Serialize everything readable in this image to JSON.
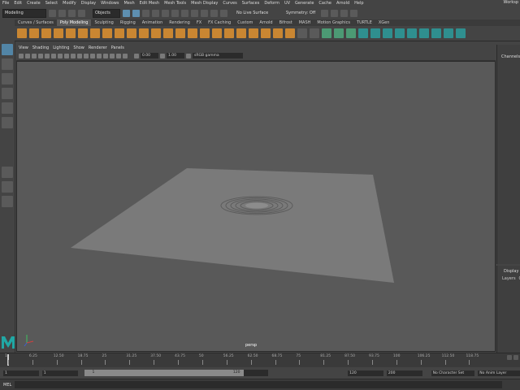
{
  "menubar": {
    "items": [
      "File",
      "Edit",
      "Create",
      "Select",
      "Modify",
      "Display",
      "Windows",
      "Mesh",
      "Edit Mesh",
      "Mesh Tools",
      "Mesh Display",
      "Curves",
      "Surfaces",
      "Deform",
      "UV",
      "Generate",
      "Cache",
      "Arnold",
      "Help"
    ],
    "workspace": "Worksp"
  },
  "statusline": {
    "mode": "Modeling",
    "objects": "Objects",
    "live_surface": "No Live Surface",
    "symmetry": "Symmetry: Off"
  },
  "shelf": {
    "tabs": [
      "Curves / Surfaces",
      "Poly Modeling",
      "Sculpting",
      "Rigging",
      "Animation",
      "Rendering",
      "FX",
      "FX Caching",
      "Custom",
      "Arnold",
      "Bifrost",
      "MASH",
      "Motion Graphics",
      "TURTLE",
      "XGen"
    ],
    "active_tab": "Poly Modeling"
  },
  "viewport": {
    "menus": [
      "View",
      "Shading",
      "Lighting",
      "Show",
      "Renderer",
      "Panels"
    ],
    "exposure": "0.00",
    "gamma": "1.00",
    "color_space": "sRGB gamma",
    "camera": "persp"
  },
  "channels": {
    "title": "Channels"
  },
  "layers": {
    "title": "Display",
    "tabs": [
      "Layers",
      "O"
    ]
  },
  "timeline": {
    "ticks": [
      "1",
      "6.25",
      "12.50",
      "18.75",
      "25",
      "31.25",
      "37.50",
      "43.75",
      "50",
      "56.25",
      "62.50",
      "68.75",
      "75",
      "81.25",
      "87.50",
      "93.75",
      "100",
      "106.25",
      "112.50",
      "118.75"
    ],
    "current": "1"
  },
  "range": {
    "start": "1",
    "playback_start": "1",
    "slider_start": "1",
    "slider_end": "120",
    "playback_end": "120",
    "end": "200",
    "character_set": "No Character Set",
    "anim_layer": "No Anim Layer"
  },
  "cmdline": {
    "lang": "MEL"
  },
  "colors": {
    "accent": "#5285a6",
    "shelf_orange": "#c98632",
    "viewport_bg": "#595959",
    "plane": "#7a7a7a"
  }
}
